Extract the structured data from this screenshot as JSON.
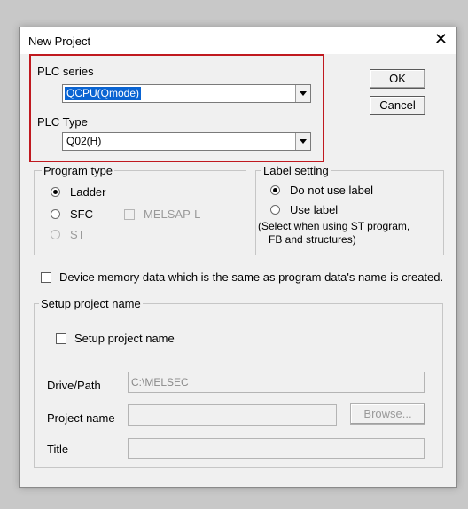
{
  "dialog": {
    "title": "New Project",
    "close_icon": "close-icon"
  },
  "plc_series": {
    "label": "PLC series",
    "value": "QCPU(Qmode)"
  },
  "plc_type": {
    "label": "PLC Type",
    "value": "Q02(H)"
  },
  "buttons": {
    "ok": "OK",
    "cancel": "Cancel",
    "browse": "Browse..."
  },
  "program_type": {
    "title": "Program type",
    "ladder": "Ladder",
    "sfc": "SFC",
    "melsap": "MELSAP-L",
    "st": "ST"
  },
  "label_setting": {
    "title": "Label setting",
    "do_not_use": "Do not use label",
    "use": "Use label",
    "note_line1": "(Select when using ST program,",
    "note_line2": "FB and structures)"
  },
  "device_memory": {
    "label": "Device memory data which is the same as program data's name is created."
  },
  "setup": {
    "group_title": "Setup project name",
    "checkbox_label": "Setup project name",
    "drive_path_label": "Drive/Path",
    "drive_path_value": "C:\\MELSEC",
    "project_name_label": "Project name",
    "project_name_value": "",
    "title_label": "Title",
    "title_value": ""
  },
  "colors": {
    "highlight": "#c0191f",
    "selection": "#0a64d2"
  }
}
